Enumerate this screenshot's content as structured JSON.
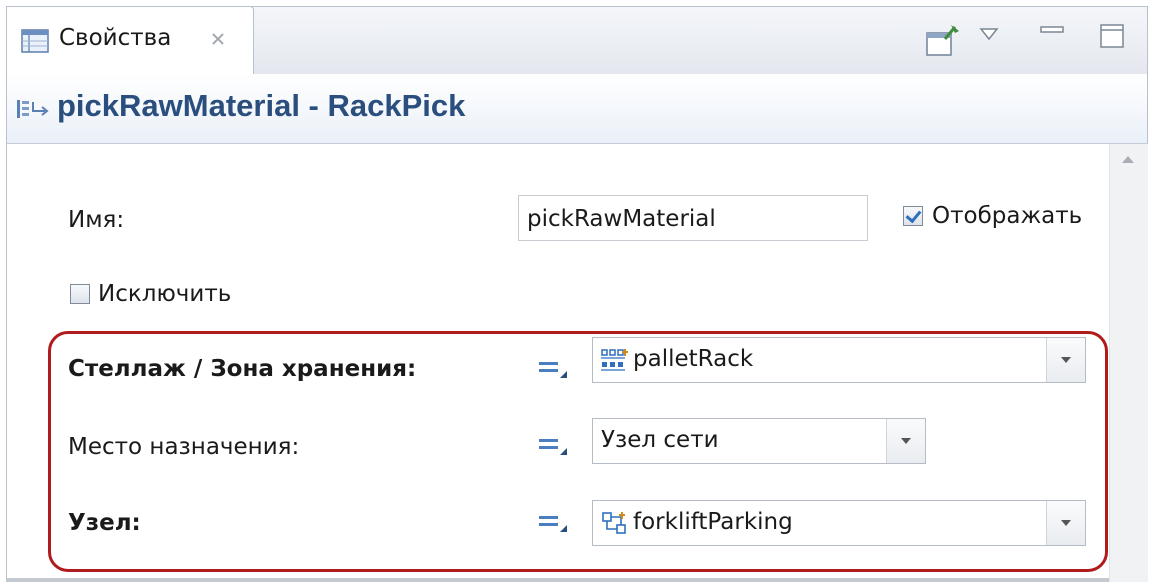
{
  "tab": {
    "label": "Свойства",
    "close_glyph": "✕",
    "icon": "properties-view-icon"
  },
  "toolbar": {
    "pin_icon": "pin-view-icon",
    "menu_icon": "view-menu-icon",
    "minimize_icon": "minimize-icon",
    "maximize_icon": "maximize-icon"
  },
  "header": {
    "icon": "block-icon",
    "title": "pickRawMaterial - RackPick"
  },
  "form": {
    "name_label": "Имя:",
    "name_value": "pickRawMaterial",
    "show_label": "Отображать",
    "show_checked": true,
    "exclude_label": "Исключить",
    "exclude_checked": false,
    "rack_label": "Стеллаж / Зона хранения:",
    "rack_value": "palletRack",
    "rack_icon": "pallet-rack-icon",
    "destination_label": "Место назначения:",
    "destination_value": "Узел сети",
    "node_label": "Узел:",
    "node_value": "forkliftParking",
    "node_icon": "network-node-icon"
  },
  "colors": {
    "title": "#2a4e7e",
    "highlight": "#b01c1c",
    "accent": "#2b6fbd"
  }
}
